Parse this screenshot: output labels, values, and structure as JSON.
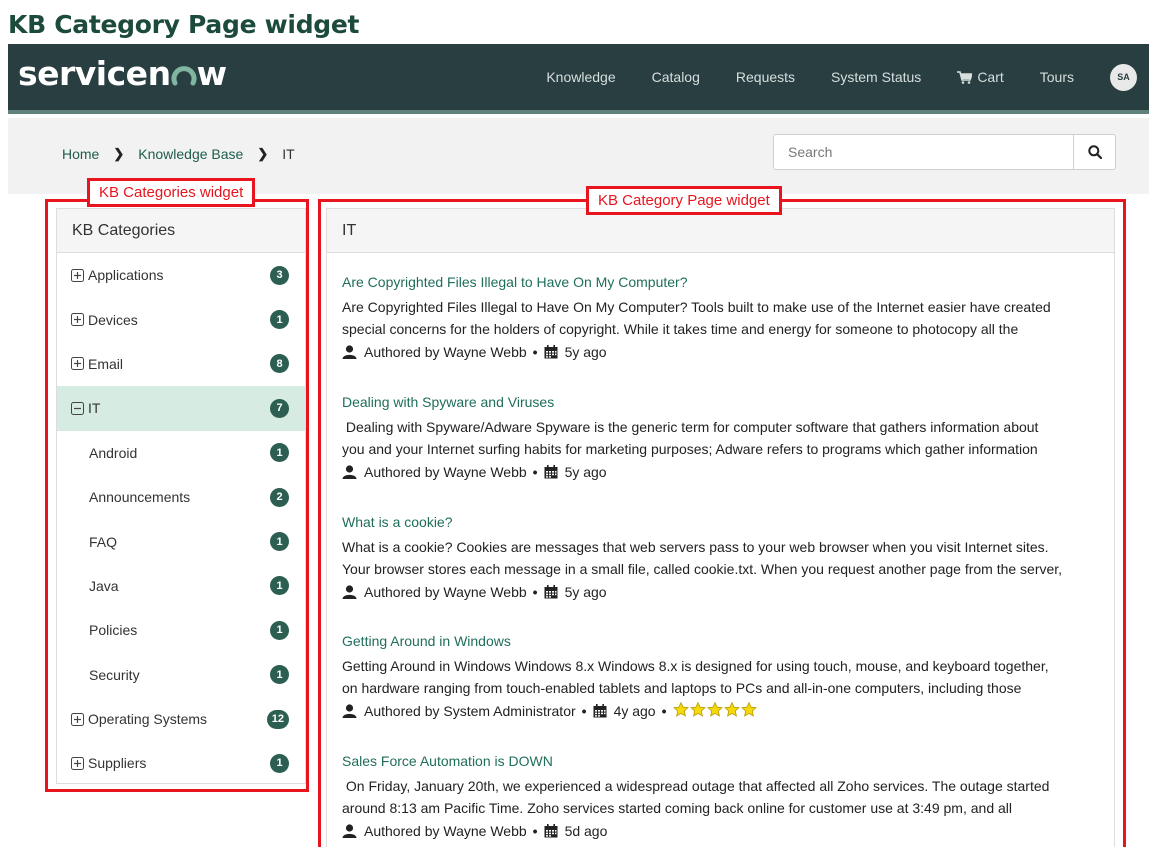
{
  "page_heading": "KB Category Page widget",
  "nav": {
    "logo_text_a": "servicen",
    "logo_text_b": "w",
    "links": [
      "Knowledge",
      "Catalog",
      "Requests",
      "System Status",
      "Cart",
      "Tours"
    ],
    "avatar": "SA"
  },
  "breadcrumb": {
    "home": "Home",
    "kb": "Knowledge Base",
    "current": "IT"
  },
  "search": {
    "placeholder": "Search"
  },
  "annotations": {
    "left": "KB Categories widget",
    "right": "KB Category Page widget"
  },
  "categories": {
    "title": "KB Categories",
    "items": [
      {
        "label": "Applications",
        "count": "3",
        "toggle": "expand-icon"
      },
      {
        "label": "Devices",
        "count": "1",
        "toggle": "expand-icon"
      },
      {
        "label": "Email",
        "count": "8",
        "toggle": "expand-icon"
      },
      {
        "label": "IT",
        "count": "7",
        "toggle": "collapse-icon"
      },
      {
        "label": "Android",
        "count": "1"
      },
      {
        "label": "Announcements",
        "count": "2"
      },
      {
        "label": "FAQ",
        "count": "1"
      },
      {
        "label": "Java",
        "count": "1"
      },
      {
        "label": "Policies",
        "count": "1"
      },
      {
        "label": "Security",
        "count": "1"
      },
      {
        "label": "Operating Systems",
        "count": "12",
        "toggle": "expand-icon"
      },
      {
        "label": "Suppliers",
        "count": "1",
        "toggle": "expand-icon"
      }
    ]
  },
  "articles": {
    "title": "IT",
    "items": [
      {
        "title": "Are Copyrighted Files Illegal to Have On My Computer?",
        "line1": "Are Copyrighted Files Illegal to Have On My Computer? Tools built to make use of the Internet easier have created",
        "line2": "special concerns for the holders of copyright. While it takes time and energy for someone to photocopy all the",
        "author": "Authored by Wayne Webb",
        "age": "5y ago"
      },
      {
        "title": "Dealing with Spyware and Viruses",
        "line1": " Dealing with Spyware/Adware Spyware is the generic term for computer software that gathers information about",
        "line2": "you and your Internet surfing habits for marketing purposes; Adware refers to programs which gather information",
        "author": "Authored by Wayne Webb",
        "age": "5y ago"
      },
      {
        "title": "What is a cookie?",
        "line1": "What is a cookie? Cookies are messages that web servers pass to your web browser when you visit Internet sites.",
        "line2": "Your browser stores each message in a small file, called cookie.txt. When you request another page from the server,",
        "author": "Authored by Wayne Webb",
        "age": "5y ago"
      },
      {
        "title": "Getting Around in Windows",
        "line1": "Getting Around in Windows Windows 8.x Windows 8.x is designed for using touch, mouse, and keyboard together,",
        "line2": "on hardware ranging from touch-enabled tablets and laptops to PCs and all-in-one computers, including those",
        "author": "Authored by System Administrator",
        "age": "4y ago",
        "rating": 5
      },
      {
        "title": "Sales Force Automation is DOWN",
        "line1": " On Friday, January 20th, we experienced a widespread outage that affected all Zoho services. The outage started",
        "line2": "around 8:13 am Pacific Time. Zoho services started coming back online for customer use at 3:49 pm, and all",
        "author": "Authored by Wayne Webb",
        "age": "5d ago"
      }
    ]
  },
  "colors": {
    "nav_bg": "#293e40",
    "accent": "#2d5e52",
    "link": "#1f6e5c",
    "annotation": "#e8141e"
  }
}
